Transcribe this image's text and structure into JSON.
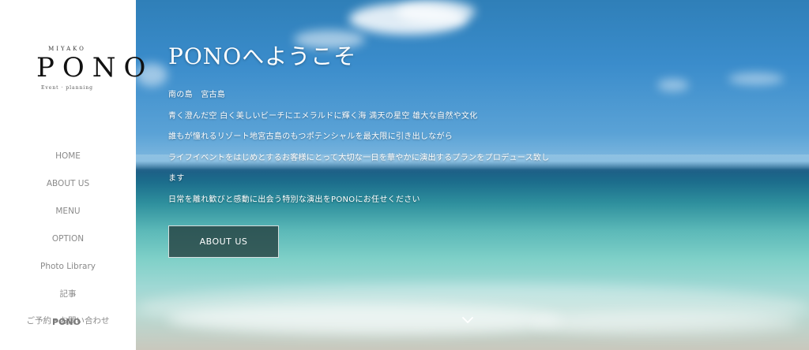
{
  "sidebar": {
    "logo": {
      "top": "MIYAKO",
      "mark": "PONO",
      "sub": "Event · planning"
    },
    "nav": [
      {
        "label": "HOME"
      },
      {
        "label": "ABOUT US"
      },
      {
        "label": "MENU"
      },
      {
        "label": "OPTION"
      },
      {
        "label": "Photo Library"
      },
      {
        "label": "記事"
      },
      {
        "label": "ご予約・お問い合わせ"
      }
    ],
    "brand_overlay": "PONO"
  },
  "hero": {
    "title": "PONOへようこそ",
    "lines": [
      "南の島　宮古島",
      "青く澄んだ空 白く美しいビーチにエメラルドに輝く海 満天の星空 雄大な自然や文化",
      "誰もが憧れるリゾート地宮古島のもつポテンシャルを最大限に引き出しながら",
      "ライフイベントをはじめとするお客様にとって大切な一日を華やかに演出するプランをプロデュース致し",
      "ます",
      "日常を離れ歓びと感動に出会う特別な演出をPONOにお任せください"
    ],
    "button_label": "ABOUT US",
    "scroll_icon": "chevron-down-icon"
  }
}
